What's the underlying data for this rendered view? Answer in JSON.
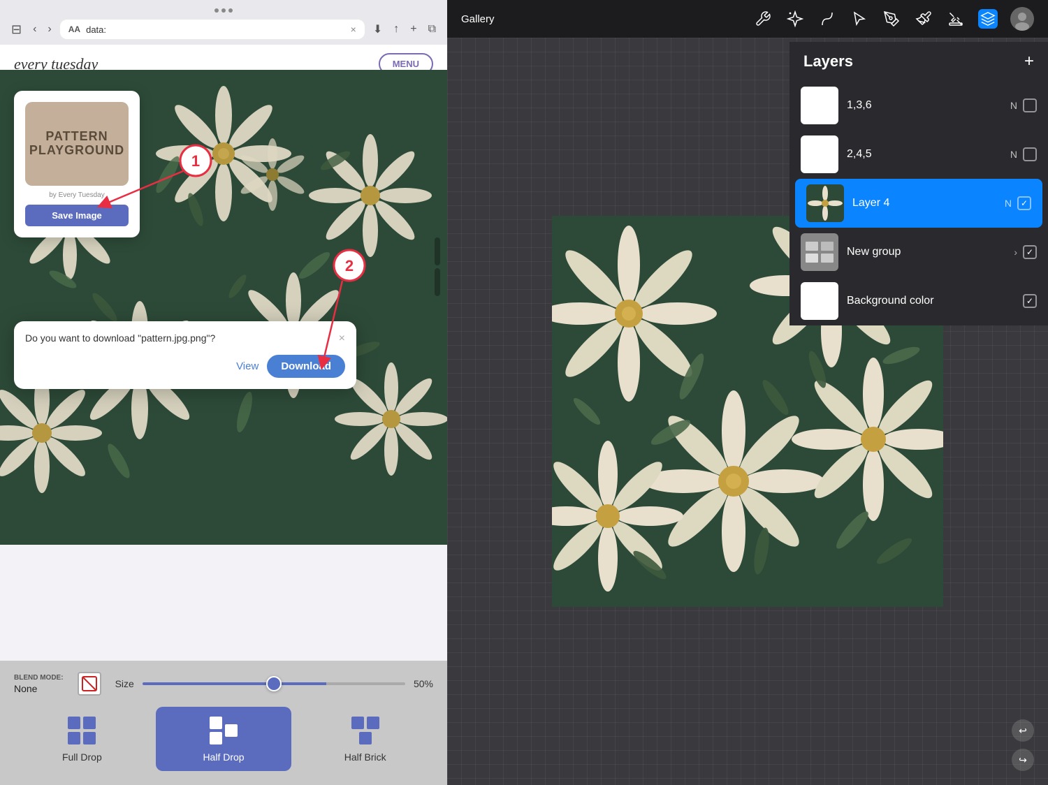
{
  "browser": {
    "dots": [
      "",
      "",
      ""
    ],
    "aa_label": "AA",
    "url": "data:",
    "close_icon": "×",
    "back_icon": "‹",
    "forward_icon": "›",
    "sidebar_icon": "⊟",
    "download_icon": "⬇",
    "share_icon": "↑",
    "add_icon": "+",
    "tabs_icon": "⧉"
  },
  "website": {
    "brand": "every tuesday",
    "menu_label": "MENU"
  },
  "pattern_card": {
    "logo_line1": "PATTERN",
    "logo_line2": "PLAYGROUND",
    "by_text": "by Every Tuesday",
    "save_button": "Save Image"
  },
  "dialog": {
    "message": "Do you want to download \"pattern.jpg.png\"?",
    "close_icon": "×",
    "view_label": "View",
    "download_label": "Download"
  },
  "annotations": {
    "num1": "1",
    "num2": "2"
  },
  "bottom_controls": {
    "blend_label": "Blend Mode:",
    "blend_value": "None",
    "size_label": "Size",
    "size_percent": "50%",
    "slider_value": 50,
    "pattern_types": [
      {
        "id": "full-drop",
        "label": "Full Drop",
        "active": false
      },
      {
        "id": "half-drop",
        "label": "Half Drop",
        "active": true
      },
      {
        "id": "half-brick",
        "label": "Half Brick",
        "active": false
      }
    ]
  },
  "procreate": {
    "gallery_label": "Gallery",
    "tools": [
      "wrench",
      "magic",
      "scribble-s",
      "arrow",
      "pen",
      "brush",
      "eraser",
      "layers"
    ],
    "layers_title": "Layers",
    "layers_add": "+",
    "layers": [
      {
        "id": "layer-136",
        "name": "1,3,6",
        "mode": "N",
        "active": false,
        "thumb": "white",
        "checked": false
      },
      {
        "id": "layer-245",
        "name": "2,4,5",
        "mode": "N",
        "active": false,
        "thumb": "white",
        "checked": false
      },
      {
        "id": "layer-4",
        "name": "Layer 4",
        "mode": "N",
        "active": true,
        "thumb": "dark",
        "checked": true
      },
      {
        "id": "new-group",
        "name": "New group",
        "mode": "",
        "active": false,
        "thumb": "gray",
        "checked": true,
        "hasArrow": true
      },
      {
        "id": "bg-color",
        "name": "Background color",
        "mode": "",
        "active": false,
        "thumb": "white-plain",
        "checked": true
      }
    ]
  }
}
